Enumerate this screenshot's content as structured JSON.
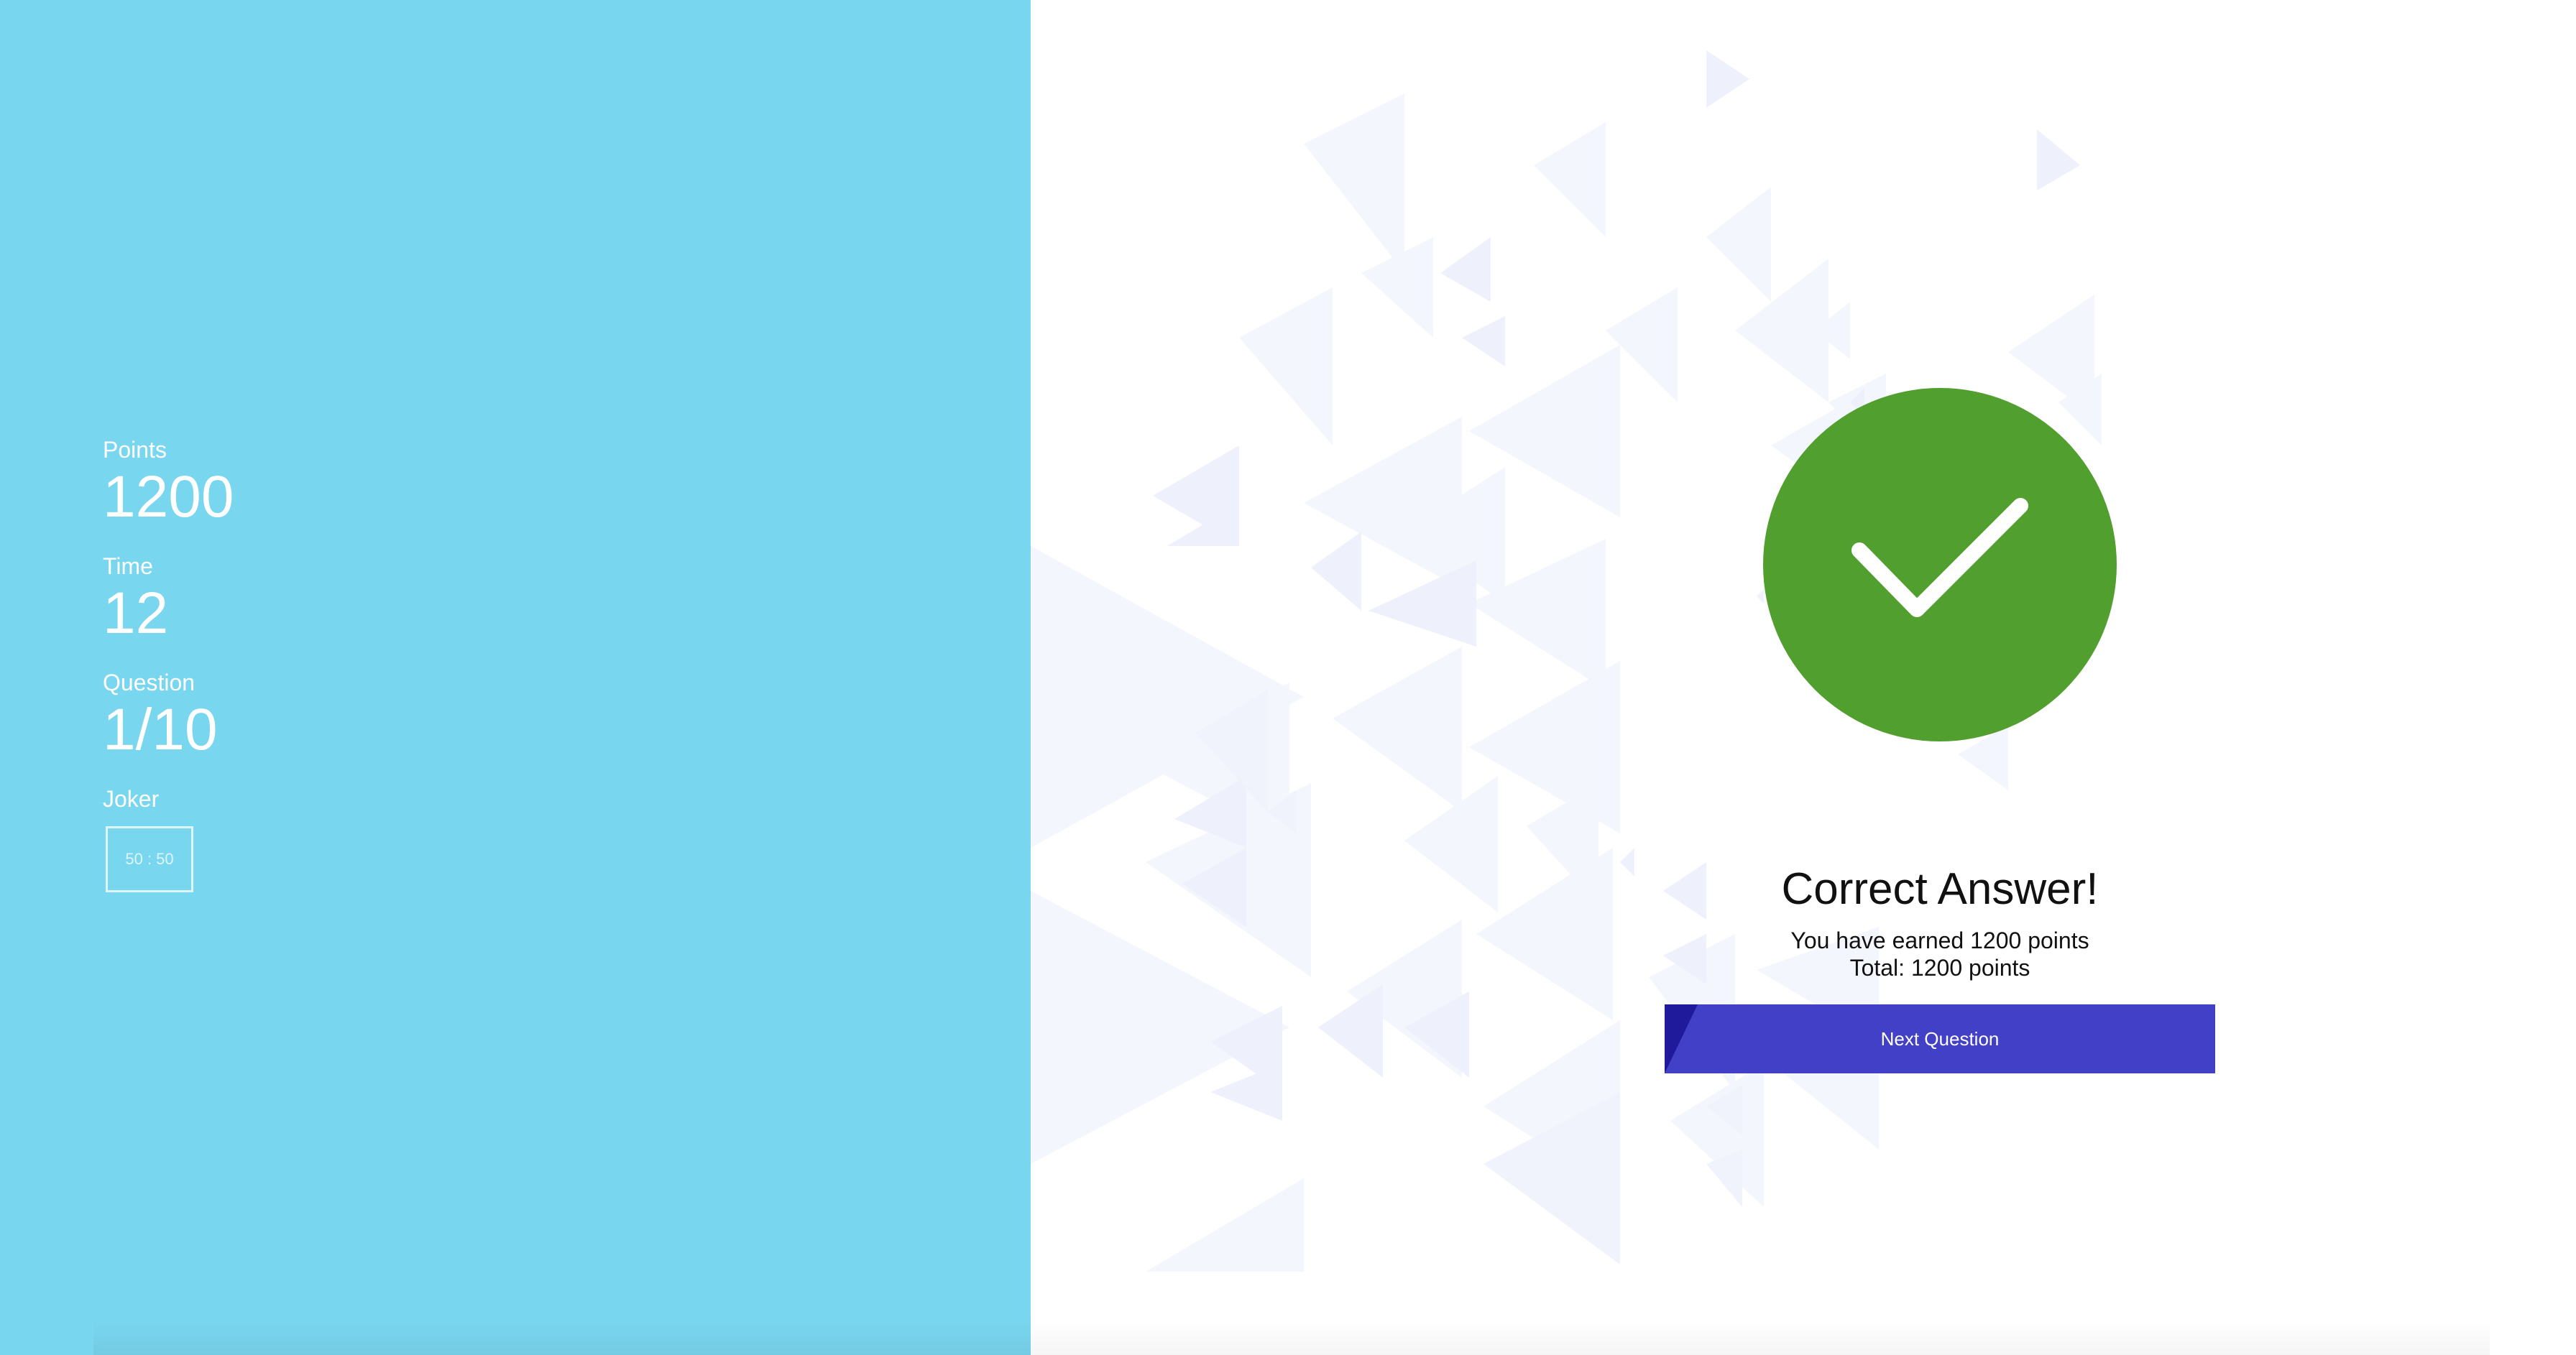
{
  "sidebar": {
    "points_label": "Points",
    "points_value": "1200",
    "time_label": "Time",
    "time_value": "12",
    "question_label": "Question",
    "question_value": "1/10",
    "joker_label": "Joker",
    "joker_button_label": "50 : 50"
  },
  "result": {
    "icon": "checkmark-icon",
    "title": "Correct Answer!",
    "earned_text": "You have earned 1200 points",
    "total_text": "Total: 1200 points",
    "next_button_label": "Next Question"
  },
  "colors": {
    "sidebar_bg": "#79d6ef",
    "success_green": "#519f2e",
    "button_blue": "#4340c8",
    "button_accent": "#1f1a9c"
  }
}
